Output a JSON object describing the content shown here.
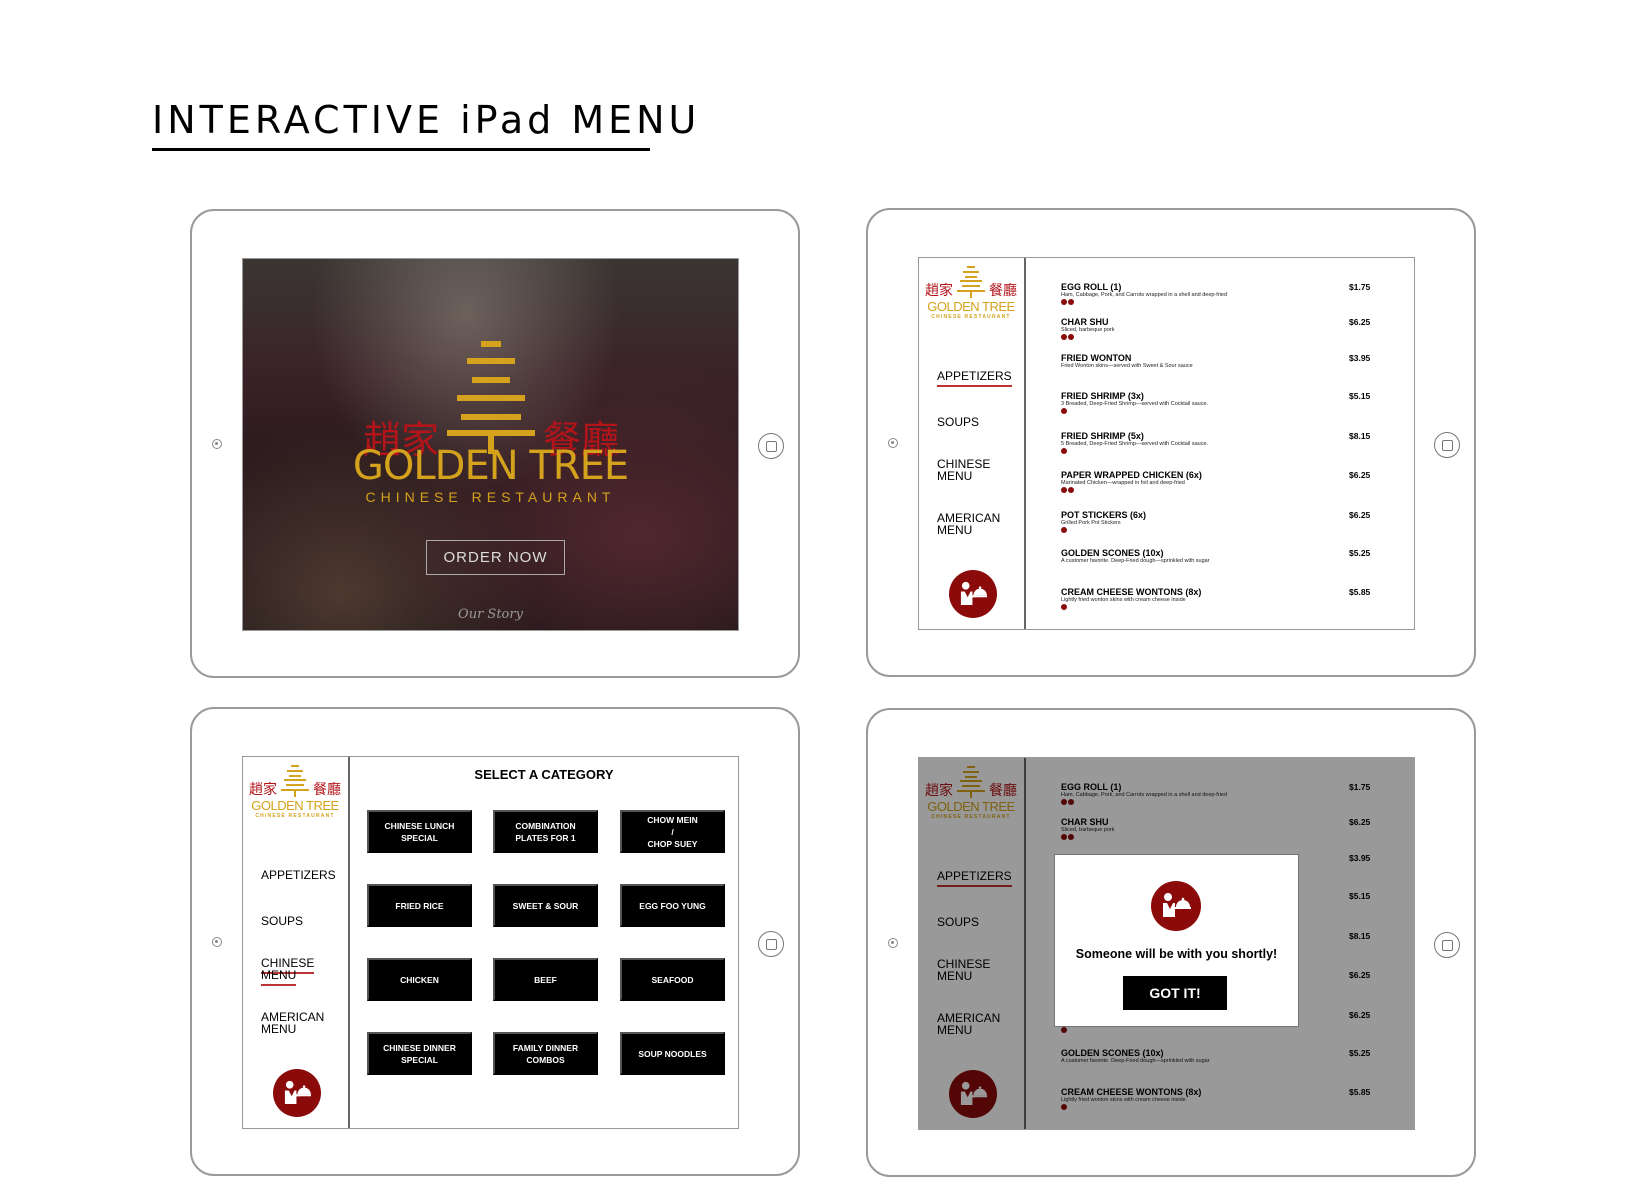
{
  "page_title": "INTERACTIVE iPad MENU",
  "brand": {
    "name": "GOLDEN TREE",
    "subtitle": "CHINESE   RESTAURANT",
    "logo_cn_left": "趙家",
    "logo_cn_right": "餐廳",
    "gold": "#d4a21c",
    "red": "#8b0a0a"
  },
  "home_screen": {
    "order_label": "ORDER NOW",
    "story_label": "Our Story"
  },
  "sidebar": {
    "items": [
      {
        "label": "APPETIZERS"
      },
      {
        "label": "SOUPS"
      },
      {
        "label": "CHINESE MENU"
      },
      {
        "label": "AMERICAN MENU"
      }
    ],
    "call_waiter_icon": "waiter-icon"
  },
  "menu": {
    "items": [
      {
        "name": "EGG ROLL (1)",
        "desc": "Ham, Cabbage, Pork, and Carrots wrapped in a shell and deep-fried",
        "price": "$1.75",
        "badges": 2
      },
      {
        "name": "CHAR SHU",
        "desc": "Sliced, barbeque pork",
        "price": "$6.25",
        "badges": 2
      },
      {
        "name": "FRIED WONTON",
        "desc": "Fried Wonton skins—served with Sweet & Sour sauce",
        "price": "$3.95",
        "badges": 0
      },
      {
        "name": "FRIED SHRIMP (3x)",
        "desc": "3 Breaded, Deep-Fried Shrimp—served with Cocktail sauce.",
        "price": "$5.15",
        "badges": 1
      },
      {
        "name": "FRIED SHRIMP (5x)",
        "desc": "5 Breaded, Deep-Fried Shrimp—served with Cocktail sauce.",
        "price": "$8.15",
        "badges": 1
      },
      {
        "name": "PAPER WRAPPED CHICKEN (6x)",
        "desc": "Marinated Chicken—wrapped in foil and deep-fried",
        "price": "$6.25",
        "badges": 2
      },
      {
        "name": "POT STICKERS (6x)",
        "desc": "Grilled Pork Pot Stickers",
        "price": "$6.25",
        "badges": 1
      },
      {
        "name": "GOLDEN SCONES (10x)",
        "desc": "A customer favorite. Deep-Fried dough—sprinkled with sugar",
        "price": "$5.25",
        "badges": 0
      },
      {
        "name": "CREAM CHEESE WONTONS (8x)",
        "desc": "Lightly fried wonton skins with cream cheese inside",
        "price": "$5.85",
        "badges": 1
      }
    ]
  },
  "categories": {
    "title": "SELECT A CATEGORY",
    "items": [
      "CHINESE LUNCH\nSPECIAL",
      "COMBINATION\nPLATES FOR 1",
      "CHOW MEIN\n/\nCHOP SUEY",
      "FRIED RICE",
      "SWEET & SOUR",
      "EGG FOO YUNG",
      "CHICKEN",
      "BEEF",
      "SEAFOOD",
      "CHINESE DINNER\nSPECIAL",
      "FAMILY DINNER\nCOMBOS",
      "SOUP NOODLES"
    ]
  },
  "dialog": {
    "message": "Someone will be with you shortly!",
    "button_label": "GOT IT!"
  }
}
